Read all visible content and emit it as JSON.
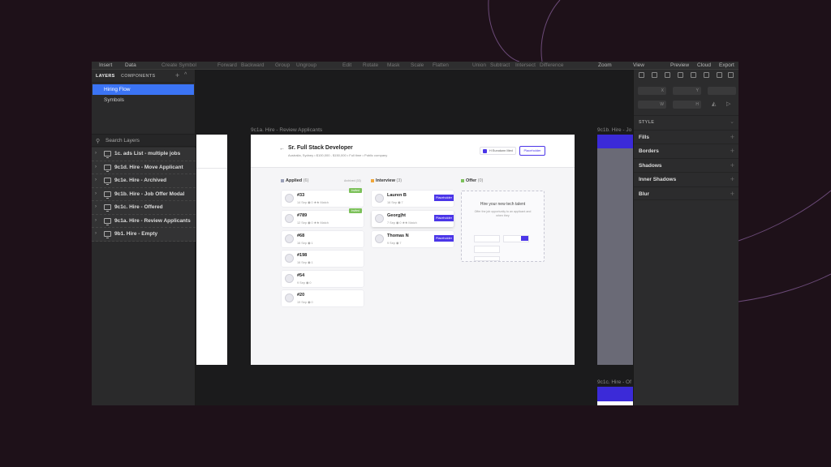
{
  "toolbar": {
    "items": [
      "Insert",
      "Data",
      "Create Symbol",
      "Forward",
      "Backward",
      "Group",
      "Ungroup",
      "Edit",
      "Rotate",
      "Mask",
      "Scale",
      "Flatten",
      "Union",
      "Subtract",
      "Intersect",
      "Difference",
      "Zoom",
      "View",
      "Preview",
      "Cloud",
      "Export"
    ]
  },
  "left_panel": {
    "tabs": [
      "LAYERS",
      "COMPONENTS"
    ],
    "pages": [
      "Hiring Flow",
      "Symbols"
    ],
    "search_placeholder": "Search Layers",
    "layers": [
      "1c. ads List - multiple jobs",
      "9c1d. Hire - Move Applicant",
      "9c1e. Hire - Archived",
      "9c1b. Hire - Job Offer Modal",
      "9c1c. Hire - Offered",
      "9c1a. Hire - Review Applicants",
      "9b1. Hire - Empty"
    ]
  },
  "right_panel": {
    "field_labels": [
      "X",
      "Y",
      "W",
      "H"
    ],
    "style_title": "STYLE",
    "sections": [
      "Fills",
      "Borders",
      "Shadows",
      "Inner Shadows",
      "Blur"
    ]
  },
  "canvas": {
    "frames": [
      "9c1a. Hire - Review Applicants",
      "9c1b. Hire - Jo",
      "9c1c. Hire - Of"
    ],
    "main": {
      "job_title": "Sr. Full Stack Developer",
      "job_meta": "Australia, Sydney  •  $100,000 - $150,000  •  Full time  •  Public company",
      "user_label": "H Eurodunn Med",
      "header_button": "Placeholder",
      "columns": [
        {
          "title": "Applied",
          "count": "(6)",
          "extra": "Archived (33)",
          "color": "#9aa0b8"
        },
        {
          "title": "Interview",
          "count": "(3)",
          "extra": "",
          "color": "#f0a73a"
        },
        {
          "title": "Offer",
          "count": "(0)",
          "extra": "",
          "color": "#7cc15a"
        }
      ],
      "applied_cards": [
        {
          "name": "#33",
          "meta": "14 Sep   ◉ 0   ★★ Match",
          "tag": "Invited"
        },
        {
          "name": "#789",
          "meta": "12 Sep   ◉ 0   ★★ Match",
          "tag": "Invited"
        },
        {
          "name": "#68",
          "meta": "16 Sep   ◉ 1",
          "tag": ""
        },
        {
          "name": "#198",
          "meta": "16 Sep   ◉ 1",
          "tag": ""
        },
        {
          "name": "#54",
          "meta": "9 Sep   ◉ 0",
          "tag": ""
        },
        {
          "name": "#20",
          "meta": "19 Sep   ◉ 0",
          "tag": ""
        }
      ],
      "interview_cards": [
        {
          "name": "Lauren B",
          "meta": "16 Sep   ◉ 7",
          "ph": "Placeholder"
        },
        {
          "name": "Georg|ht",
          "meta": "7 Sep   ◉ 0   ★★ Match",
          "ph": "Placeholder"
        },
        {
          "name": "Thomas N",
          "meta": "9 Sep   ◉ 7",
          "ph": "Placeholder"
        }
      ],
      "offer_title": "Hire your new tech talent",
      "offer_text": "Offer the job opportunity to an applicant and when they"
    }
  }
}
